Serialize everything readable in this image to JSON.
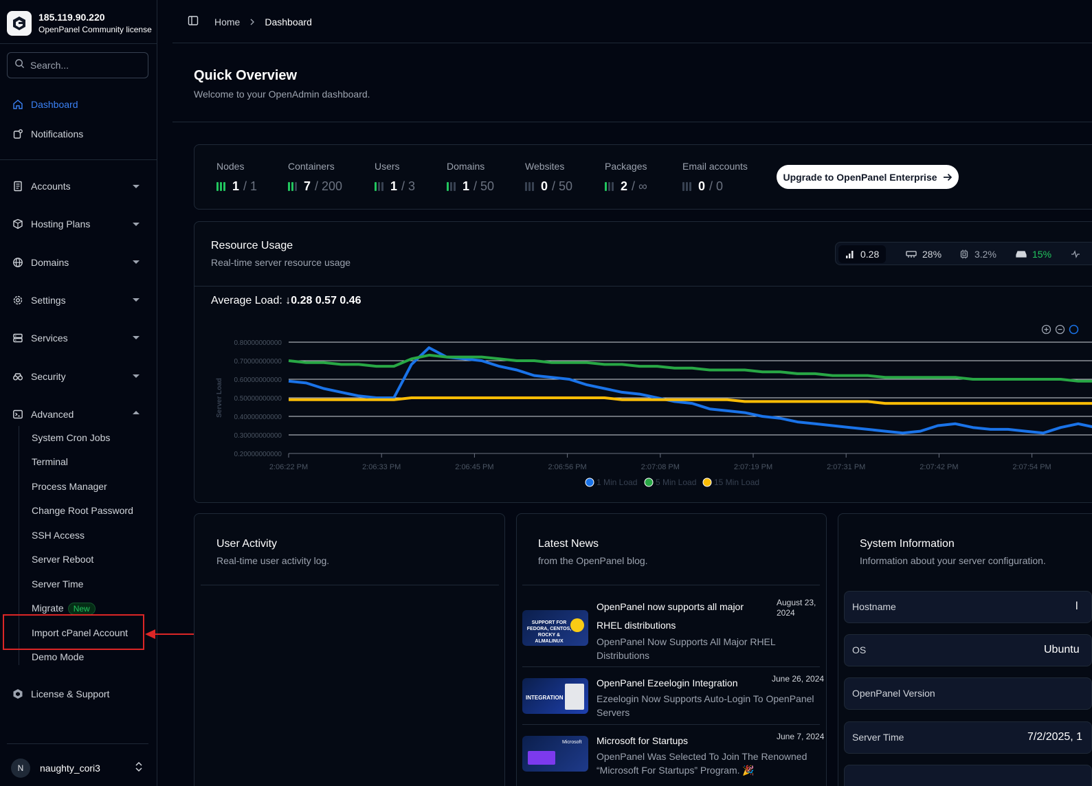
{
  "brand": {
    "ip": "185.119.90.220",
    "license": "OpenPanel Community license"
  },
  "search": {
    "placeholder": "Search..."
  },
  "nav": {
    "dashboard": "Dashboard",
    "notifications": "Notifications",
    "accounts": "Accounts",
    "hosting_plans": "Hosting Plans",
    "domains": "Domains",
    "settings": "Settings",
    "services": "Services",
    "security": "Security",
    "advanced": "Advanced",
    "license": "License & Support"
  },
  "advanced_items": {
    "cron": "System Cron Jobs",
    "terminal": "Terminal",
    "process": "Process Manager",
    "root_pw": "Change Root Password",
    "ssh": "SSH Access",
    "reboot": "Server Reboot",
    "time": "Server Time",
    "migrate": "Migrate",
    "migrate_badge": "New",
    "import": "Import cPanel Account",
    "demo": "Demo Mode"
  },
  "user": {
    "initial": "N",
    "name": "naughty_cori3"
  },
  "breadcrumb": {
    "home": "Home",
    "current": "Dashboard"
  },
  "page": {
    "title": "Quick Overview",
    "subtitle": "Welcome to your OpenAdmin dashboard."
  },
  "stats": [
    {
      "label": "Nodes",
      "value": "1",
      "total": "/ 1",
      "level": 3
    },
    {
      "label": "Containers",
      "value": "7",
      "total": "/ 200",
      "level": 2
    },
    {
      "label": "Users",
      "value": "1",
      "total": "/ 3",
      "level": 1
    },
    {
      "label": "Domains",
      "value": "1",
      "total": "/ 50",
      "level": 1
    },
    {
      "label": "Websites",
      "value": "0",
      "total": "/ 50",
      "level": 0
    },
    {
      "label": "Packages",
      "value": "2",
      "total": "/ ∞",
      "level": 1
    },
    {
      "label": "Email accounts",
      "value": "0",
      "total": "/ 0",
      "level": 0
    }
  ],
  "upgrade": {
    "label": "Upgrade to OpenPanel Enterprise"
  },
  "resource": {
    "title": "Resource Usage",
    "subtitle": "Real-time server resource usage",
    "tabs": {
      "load": "0.28",
      "ram": "28%",
      "cpu": "3.2%",
      "disk": "15%"
    },
    "avg_label": "Average Load:",
    "avg_arrow": "↓",
    "avg_values": "0.28 0.57 0.46"
  },
  "chart_data": {
    "type": "line",
    "ylabel": "Server Load",
    "ylim": [
      0.2,
      0.8
    ],
    "yticks": [
      "0.80000000000",
      "0.70000000000",
      "0.60000000000",
      "0.50000000000",
      "0.40000000000",
      "0.30000000000",
      "0.20000000000"
    ],
    "xticks": [
      "2:06:22 PM",
      "2:06:33 PM",
      "2:06:45 PM",
      "2:06:56 PM",
      "2:07:08 PM",
      "2:07:19 PM",
      "2:07:31 PM",
      "2:07:42 PM",
      "2:07:54 PM"
    ],
    "series": [
      {
        "name": "1 Min Load",
        "color": "#1a73e8",
        "values": [
          0.59,
          0.58,
          0.55,
          0.53,
          0.51,
          0.5,
          0.5,
          0.68,
          0.77,
          0.72,
          0.71,
          0.7,
          0.67,
          0.65,
          0.62,
          0.61,
          0.6,
          0.57,
          0.55,
          0.53,
          0.52,
          0.5,
          0.48,
          0.47,
          0.44,
          0.43,
          0.42,
          0.4,
          0.39,
          0.37,
          0.36,
          0.35,
          0.34,
          0.33,
          0.32,
          0.31,
          0.32,
          0.35,
          0.36,
          0.34,
          0.33,
          0.33,
          0.32,
          0.31,
          0.34,
          0.36,
          0.34,
          0.33
        ]
      },
      {
        "name": "5 Min Load",
        "color": "#28a745",
        "values": [
          0.7,
          0.69,
          0.69,
          0.68,
          0.68,
          0.67,
          0.67,
          0.71,
          0.73,
          0.72,
          0.72,
          0.72,
          0.71,
          0.7,
          0.7,
          0.69,
          0.69,
          0.69,
          0.68,
          0.68,
          0.67,
          0.67,
          0.66,
          0.66,
          0.65,
          0.65,
          0.65,
          0.64,
          0.64,
          0.63,
          0.63,
          0.62,
          0.62,
          0.62,
          0.61,
          0.61,
          0.61,
          0.61,
          0.61,
          0.6,
          0.6,
          0.6,
          0.6,
          0.6,
          0.6,
          0.59,
          0.59,
          0.59
        ]
      },
      {
        "name": "15 Min Load",
        "color": "#fbbc05",
        "values": [
          0.49,
          0.49,
          0.49,
          0.49,
          0.49,
          0.49,
          0.49,
          0.5,
          0.5,
          0.5,
          0.5,
          0.5,
          0.5,
          0.5,
          0.5,
          0.5,
          0.5,
          0.5,
          0.5,
          0.49,
          0.49,
          0.49,
          0.49,
          0.49,
          0.49,
          0.49,
          0.48,
          0.48,
          0.48,
          0.48,
          0.48,
          0.48,
          0.48,
          0.48,
          0.47,
          0.47,
          0.47,
          0.47,
          0.47,
          0.47,
          0.47,
          0.47,
          0.47,
          0.47,
          0.47,
          0.47,
          0.47,
          0.47
        ]
      }
    ]
  },
  "activity": {
    "title": "User Activity",
    "subtitle": "Real-time user activity log."
  },
  "news": {
    "title": "Latest News",
    "subtitle": "from the OpenPanel blog.",
    "items": [
      {
        "title": "OpenPanel now supports all major RHEL distributions",
        "date": "August 23, 2024",
        "desc": "OpenPanel Now Supports All Major RHEL Distributions",
        "thumb": "SUPPORT FOR FEDORA, CENTOS, ROCKY & ALMALINUX"
      },
      {
        "title": "OpenPanel Ezeelogin Integration",
        "date": "June 26, 2024",
        "desc": "Ezeelogin Now Supports Auto-Login To OpenPanel Servers",
        "thumb": "INTEGRATION"
      },
      {
        "title": "Microsoft for Startups",
        "date": "June 7, 2024",
        "desc": "OpenPanel Was Selected To Join The Renowned “Microsoft For Startups” Program. 🎉",
        "thumb": "Microsoft"
      }
    ]
  },
  "sysinfo": {
    "title": "System Information",
    "subtitle": "Information about your server configuration.",
    "rows": [
      {
        "key": "Hostname",
        "value": "l"
      },
      {
        "key": "OS",
        "value": "Ubuntu"
      },
      {
        "key": "OpenPanel Version",
        "value": ""
      },
      {
        "key": "Server Time",
        "value": "7/2/2025, 1"
      }
    ]
  }
}
